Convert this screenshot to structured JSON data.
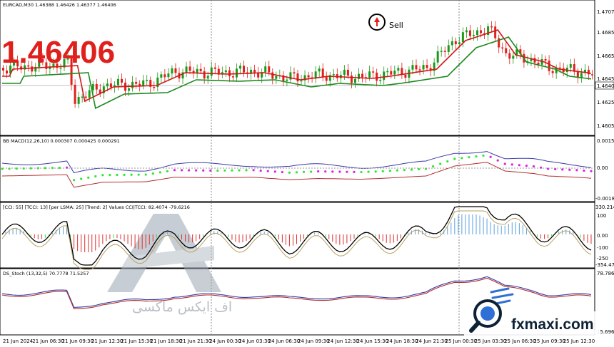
{
  "chart": {
    "symbol_header": "EURCAD,M30  1.46388 1.46426 1.46377 1.46406",
    "big_price": "1.46406",
    "sell_label": "Sell",
    "price_axis": [
      "1.47070",
      "1.46850",
      "1.46655",
      "1.46455",
      "1.46406",
      "1.46255",
      "1.46055"
    ],
    "current_price_tag": "1.46406",
    "time_axis": [
      "21 Jun 2024",
      "21 Jun 06:30",
      "21 Jun 09:30",
      "21 Jun 12:30",
      "21 Jun 15:30",
      "21 Jun 18:30",
      "21 Jun 21:30",
      "24 Jun 00:30",
      "24 Jun 03:30",
      "24 Jun 06:30",
      "24 Jun 09:30",
      "24 Jun 12:30",
      "24 Jun 15:30",
      "24 Jun 18:30",
      "24 Jun 21:30",
      "25 Jun 00:30",
      "25 Jun 03:30",
      "25 Jun 06:30",
      "25 Jun 09:30",
      "25 Jun 12:30"
    ]
  },
  "macd": {
    "header": "BB MACD(12,26,10) 0.000307 0.000425 0.000291",
    "axis": [
      "0.001574",
      "0.00",
      "-0.001862"
    ]
  },
  "cci": {
    "header": "[CCI: 55] [TCCI: 13] [per LSMA: 25] [Trend: 2] Values CCI|TCCI: 82.4074 -79.6216",
    "axis": [
      "330.2141",
      "100",
      "0.00",
      "-100",
      "-250",
      "-354.4773"
    ]
  },
  "stoch": {
    "header": "DS_Stoch (13,32,5) 70.7778 71.5257",
    "axis": [
      "78.7866",
      "15.6961"
    ]
  },
  "watermark": {
    "persian_text": "اف ایکس ماکسی",
    "brand_text": "fxmaxi.com"
  },
  "colors": {
    "bull_candle": "#1a9a1a",
    "bear_candle": "#e0201c",
    "ma_red": "#d01818",
    "ma_green": "#1e8a1e",
    "macd_blue": "#3a3aa8",
    "macd_red": "#b03030",
    "dot_green": "#2ee82e",
    "dot_magenta": "#e020e0",
    "brand_dark": "#0d2236",
    "brand_blue": "#2f6fd6"
  }
}
